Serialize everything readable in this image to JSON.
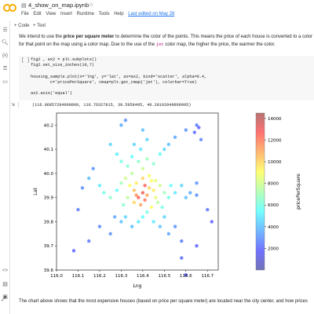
{
  "header": {
    "filename": "4_show_on_map.ipynb",
    "menu": [
      "File",
      "Edit",
      "View",
      "Insert",
      "Runtime",
      "Tools",
      "Help"
    ],
    "last_edited": "Last edited on May 28"
  },
  "toolbar": {
    "code_label": "+ Code",
    "text_label": "+ Text"
  },
  "markdown": {
    "line1_pre": "We intend to use the ",
    "line1_bold": "price per square meter",
    "line1_post": " to determine the color of the points. This means the price of each house is converted to a color",
    "line2_pre": "for that point on the map using a color map. Due to the use of the ",
    "line2_code": "jet",
    "line2_post": " color map, the higher the price, the warmer the color."
  },
  "code_cell": {
    "bracket": "[ ]",
    "lines": [
      "fig2 , ax2 = plt.subplots()",
      "fig2.set_size_inches(10,7)",
      "",
      "housing_sample.plot(x='lng', y='lat', ax=ax2, kind='scatter', alpha=0.4,",
      "        c='pricePerSquare', cmap=plt.get_cmap('jet'), colorbar=True)",
      "",
      "ax2.axis('equal')"
    ]
  },
  "output": {
    "text": "(116.06857284999999, 116.76327815, 39.5958495, 40.28102049999995)"
  },
  "bottom_text": "The chart above shows that the most expensive houses (based on price per square meter) are located near the city center, and how prices",
  "chart_data": {
    "type": "scatter",
    "xlabel": "Lng",
    "ylabel": "Lat",
    "colorbar_label": "pricePerSquare",
    "xlim": [
      116.0,
      116.75
    ],
    "ylim": [
      39.6,
      40.25
    ],
    "xticks": [
      "116.0",
      "116.1",
      "116.2",
      "116.3",
      "116.4",
      "116.5",
      "116.6",
      "116.7"
    ],
    "yticks": [
      "39.6",
      "39.7",
      "39.8",
      "39.9",
      "40.0",
      "40.1",
      "40.2"
    ],
    "colorbar_range": [
      0,
      14500
    ],
    "colorbar_ticks": [
      "2000",
      "4000",
      "6000",
      "8000",
      "10000",
      "12000",
      "14000"
    ],
    "colormap": "jet",
    "points": [
      [
        116.15,
        39.98,
        4000
      ],
      [
        116.17,
        40.02,
        3000
      ],
      [
        116.2,
        39.95,
        5000
      ],
      [
        116.22,
        39.92,
        6000
      ],
      [
        116.25,
        39.9,
        6500
      ],
      [
        116.28,
        39.93,
        5500
      ],
      [
        116.3,
        39.96,
        7000
      ],
      [
        116.32,
        39.98,
        8000
      ],
      [
        116.34,
        39.95,
        9000
      ],
      [
        116.36,
        39.93,
        10500
      ],
      [
        116.37,
        39.91,
        11500
      ],
      [
        116.38,
        39.9,
        12500
      ],
      [
        116.4,
        39.92,
        13000
      ],
      [
        116.41,
        39.89,
        12000
      ],
      [
        116.42,
        39.91,
        11000
      ],
      [
        116.43,
        39.94,
        10000
      ],
      [
        116.44,
        39.97,
        9000
      ],
      [
        116.45,
        39.93,
        9500
      ],
      [
        116.46,
        39.9,
        8500
      ],
      [
        116.47,
        39.88,
        7500
      ],
      [
        116.48,
        39.95,
        8000
      ],
      [
        116.5,
        39.92,
        7000
      ],
      [
        116.52,
        39.9,
        6000
      ],
      [
        116.55,
        39.92,
        5000
      ],
      [
        116.58,
        39.95,
        4500
      ],
      [
        116.6,
        39.9,
        4000
      ],
      [
        116.62,
        39.92,
        3500
      ],
      [
        116.65,
        39.91,
        3000
      ],
      [
        116.35,
        40.0,
        7500
      ],
      [
        116.33,
        40.03,
        6500
      ],
      [
        116.3,
        40.05,
        6000
      ],
      [
        116.28,
        40.08,
        5000
      ],
      [
        116.25,
        40.12,
        4500
      ],
      [
        116.35,
        40.07,
        5500
      ],
      [
        116.38,
        40.05,
        6500
      ],
      [
        116.4,
        40.02,
        8000
      ],
      [
        116.42,
        40.06,
        7000
      ],
      [
        116.45,
        40.04,
        6500
      ],
      [
        116.48,
        40.08,
        5500
      ],
      [
        116.5,
        40.1,
        4500
      ],
      [
        116.52,
        40.12,
        4000
      ],
      [
        116.55,
        40.15,
        3500
      ],
      [
        116.6,
        40.18,
        3000
      ],
      [
        116.65,
        40.2,
        2500
      ],
      [
        116.66,
        40.19,
        2000
      ],
      [
        116.64,
        40.17,
        2200
      ],
      [
        116.67,
        40.14,
        2800
      ],
      [
        116.3,
        40.2,
        3500
      ],
      [
        116.32,
        40.22,
        3000
      ],
      [
        116.4,
        40.18,
        4000
      ],
      [
        116.42,
        40.14,
        4500
      ],
      [
        116.39,
        40.1,
        5000
      ],
      [
        116.36,
        40.12,
        4500
      ],
      [
        116.3,
        39.8,
        4000
      ],
      [
        116.32,
        39.82,
        4500
      ],
      [
        116.35,
        39.78,
        4000
      ],
      [
        116.38,
        39.8,
        5000
      ],
      [
        116.4,
        39.82,
        5500
      ],
      [
        116.42,
        39.84,
        6000
      ],
      [
        116.45,
        39.8,
        5000
      ],
      [
        116.48,
        39.78,
        4000
      ],
      [
        116.5,
        39.82,
        4500
      ],
      [
        116.52,
        39.75,
        3500
      ],
      [
        116.55,
        39.78,
        3000
      ],
      [
        116.58,
        39.72,
        2500
      ],
      [
        116.65,
        39.7,
        2000
      ],
      [
        116.27,
        39.82,
        3500
      ],
      [
        116.25,
        39.75,
        3000
      ],
      [
        116.2,
        39.78,
        2800
      ],
      [
        116.15,
        39.72,
        2500
      ],
      [
        116.08,
        39.68,
        2000
      ],
      [
        116.1,
        39.85,
        2600
      ],
      [
        116.12,
        39.94,
        3000
      ],
      [
        116.65,
        39.96,
        3000
      ],
      [
        116.7,
        39.85,
        2500
      ],
      [
        116.72,
        39.8,
        2000
      ],
      [
        116.58,
        39.65,
        2200
      ],
      [
        116.6,
        39.58,
        1800
      ],
      [
        116.36,
        39.88,
        10000
      ],
      [
        116.39,
        39.87,
        11000
      ],
      [
        116.41,
        39.95,
        12500
      ],
      [
        116.43,
        39.99,
        9000
      ],
      [
        116.37,
        39.96,
        9500
      ],
      [
        116.46,
        39.97,
        8500
      ],
      [
        116.33,
        39.9,
        7500
      ],
      [
        116.31,
        39.87,
        6500
      ],
      [
        116.49,
        39.86,
        6000
      ],
      [
        116.53,
        39.95,
        5500
      ],
      [
        116.44,
        39.86,
        9000
      ],
      [
        116.4,
        39.98,
        10000
      ]
    ]
  }
}
